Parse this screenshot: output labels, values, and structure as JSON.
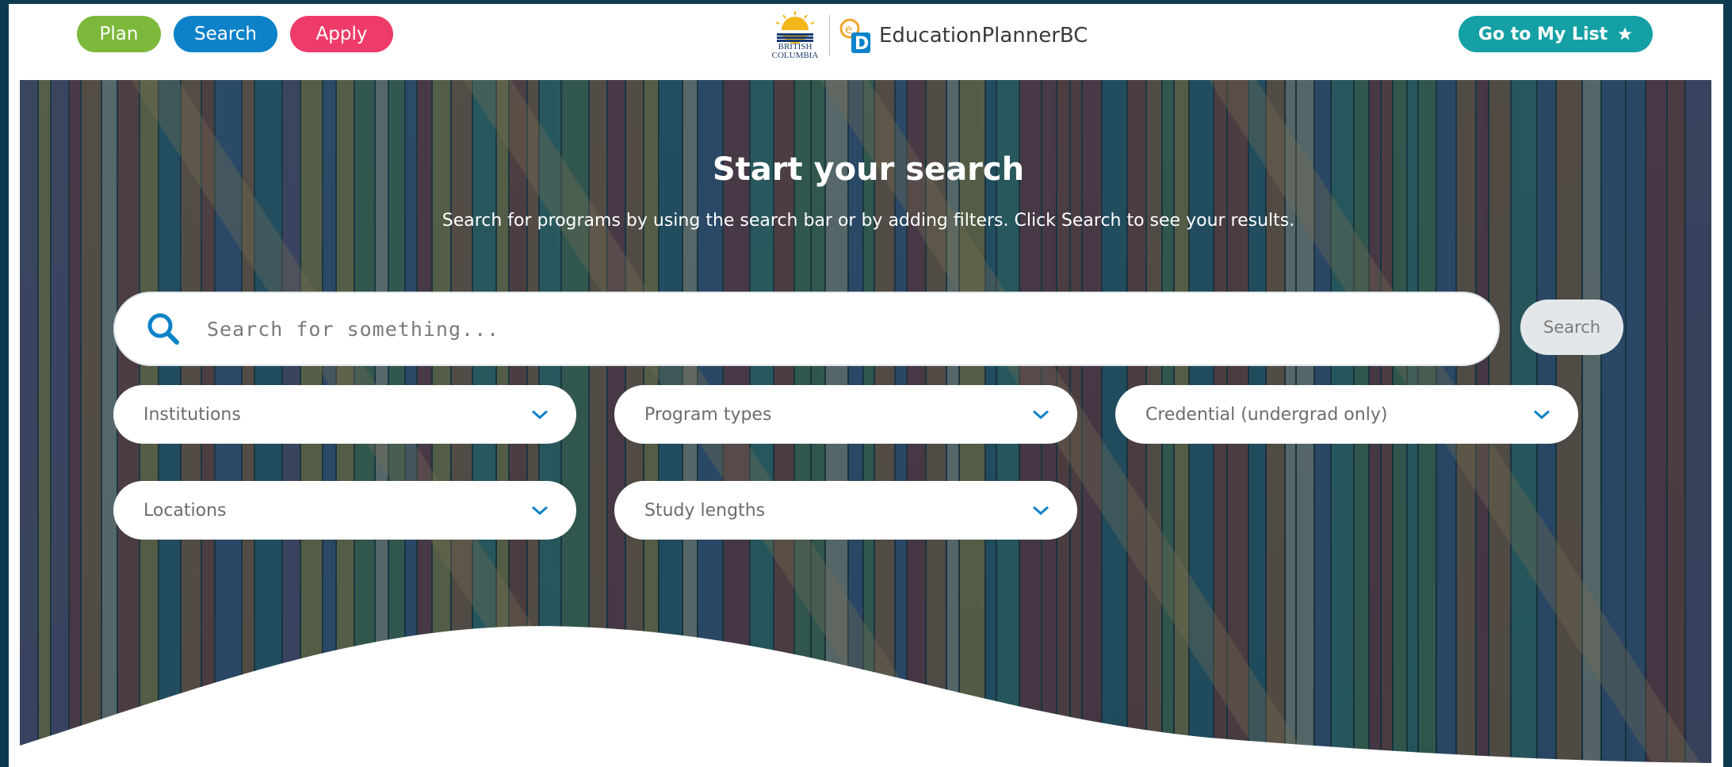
{
  "header": {
    "nav": [
      {
        "label": "Plan",
        "color": "#7cb83a"
      },
      {
        "label": "Search",
        "color": "#0d82c9"
      },
      {
        "label": "Apply",
        "color": "#ee3b69"
      }
    ],
    "logo_bc_line1": "BRITISH",
    "logo_bc_line2": "COLUMBIA",
    "logo_text": "EducationPlannerBC",
    "my_list_label": "Go to My List",
    "my_list_icon": "star-icon"
  },
  "hero": {
    "title": "Start your search",
    "subtitle": "Search for programs by using the search bar or by adding filters. Click Search to see your results.",
    "search_placeholder": "Search for something...",
    "search_icon": "search-icon",
    "search_button": "Search",
    "filters": [
      {
        "label": "Institutions"
      },
      {
        "label": "Program types"
      },
      {
        "label": "Credential (undergrad only)"
      },
      {
        "label": "Locations"
      },
      {
        "label": "Study lengths"
      }
    ]
  },
  "colors": {
    "accent_blue": "#0d82c9",
    "plan_green": "#7cb83a",
    "apply_pink": "#ee3b69",
    "teal": "#15a0a5"
  }
}
